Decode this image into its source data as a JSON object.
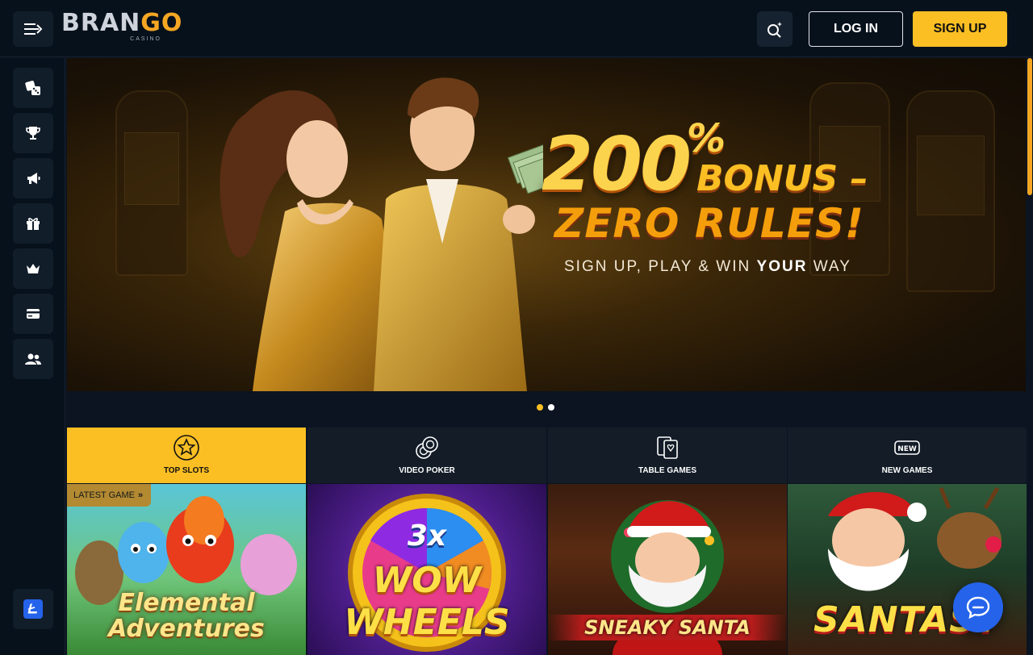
{
  "header": {
    "logo_text_a": "BRAN",
    "logo_text_b": "GO",
    "logo_sub": "CASINO",
    "login_label": "LOG IN",
    "signup_label": "SIGN UP"
  },
  "sidebar": {
    "items": [
      {
        "icon": "dice-icon"
      },
      {
        "icon": "trophy-icon"
      },
      {
        "icon": "megaphone-icon"
      },
      {
        "icon": "gift-icon"
      },
      {
        "icon": "crown-icon"
      },
      {
        "icon": "card-icon"
      },
      {
        "icon": "users-icon"
      }
    ],
    "language": "L"
  },
  "banner": {
    "amount": "200",
    "percent": "%",
    "bonus": "BONUS –",
    "zero_rules": "ZERO RULES!",
    "tagline_a": "SIGN UP, PLAY & WIN ",
    "tagline_b": "YOUR",
    "tagline_c": " WAY",
    "slide_count": 2,
    "active_slide": 1
  },
  "tabs": [
    {
      "label": "TOP SLOTS",
      "icon": "star-icon",
      "active": true
    },
    {
      "label": "VIDEO POKER",
      "icon": "chips-icon",
      "active": false
    },
    {
      "label": "TABLE GAMES",
      "icon": "cards-icon",
      "active": false
    },
    {
      "label": "NEW GAMES",
      "icon": "new-icon",
      "active": false
    }
  ],
  "latest_badge": "LATEST GAME",
  "games": [
    {
      "title_a": "Elemental",
      "title_b": "Adventures"
    },
    {
      "title_a": "3x",
      "title_b": "WOW",
      "title_c": "WHEELS"
    },
    {
      "title_a": "SNEAKY SANTA"
    },
    {
      "title_a": "SANTAST"
    }
  ],
  "colors": {
    "accent": "#fbbf24",
    "background": "#0b1420",
    "header": "#07111c",
    "chat": "#2563eb"
  }
}
